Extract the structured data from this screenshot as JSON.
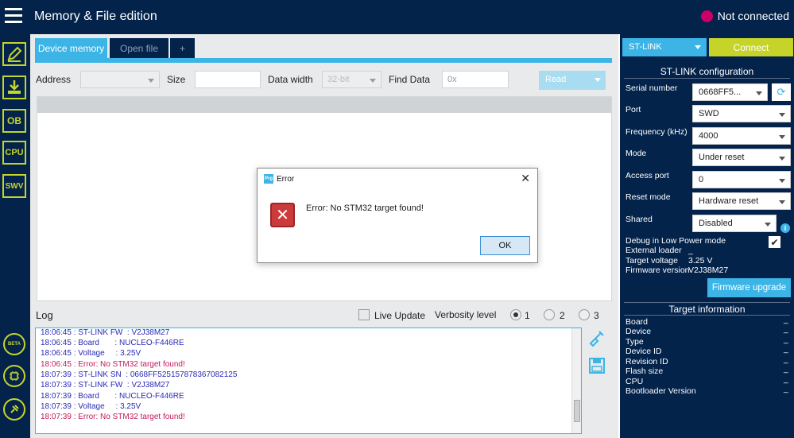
{
  "header": {
    "title": "Memory & File edition",
    "status": "Not connected",
    "status_color": "#cc0066"
  },
  "sidebar": {
    "items": [
      {
        "name": "edit-icon"
      },
      {
        "name": "download-icon"
      },
      {
        "label": "OB"
      },
      {
        "label": "CPU"
      },
      {
        "label": "SWV"
      },
      {
        "label": "BETA"
      },
      {
        "name": "chip-icon"
      },
      {
        "name": "plugin-icon"
      }
    ]
  },
  "tabs": [
    {
      "label": "Device memory"
    },
    {
      "label": "Open file"
    },
    {
      "label": "+"
    }
  ],
  "toolbar": {
    "address_label": "Address",
    "size_label": "Size",
    "data_width_label": "Data width",
    "data_width_value": "32-bit",
    "find_data_label": "Find Data",
    "find_data_placeholder": "0x",
    "read_label": "Read"
  },
  "log": {
    "label": "Log",
    "live_update_label": "Live Update",
    "verbosity_label": "Verbosity level",
    "levels": [
      "1",
      "2",
      "3"
    ],
    "selected_level": "1",
    "lines": [
      {
        "text": "18:06:45 : ST-LINK FW  : V2J38M27",
        "type": "info"
      },
      {
        "text": "18:06:45 : Board       : NUCLEO-F446RE",
        "type": "info"
      },
      {
        "text": "18:06:45 : Voltage     : 3.25V",
        "type": "info"
      },
      {
        "text": "18:06:45 : Error: No STM32 target found!",
        "type": "error"
      },
      {
        "text": "18:07:39 : ST-LINK SN  : 0668FF525157878367082125",
        "type": "info"
      },
      {
        "text": "18:07:39 : ST-LINK FW  : V2J38M27",
        "type": "info"
      },
      {
        "text": "18:07:39 : Board       : NUCLEO-F446RE",
        "type": "info"
      },
      {
        "text": "18:07:39 : Voltage     : 3.25V",
        "type": "info"
      },
      {
        "text": "18:07:39 : Error: No STM32 target found!",
        "type": "error"
      }
    ]
  },
  "dialog": {
    "title": "Error",
    "app_icon_text": "Prg",
    "message": "Error: No STM32 target found!",
    "ok_label": "OK"
  },
  "right_panel": {
    "interface": "ST-LINK",
    "connect_label": "Connect",
    "config_title": "ST-LINK configuration",
    "serial_number_label": "Serial number",
    "serial_number_value": "0668FF5...",
    "port_label": "Port",
    "port_value": "SWD",
    "frequency_label": "Frequency (kHz)",
    "frequency_value": "4000",
    "mode_label": "Mode",
    "mode_value": "Under reset",
    "access_port_label": "Access port",
    "access_port_value": "0",
    "reset_mode_label": "Reset mode",
    "reset_mode_value": "Hardware reset",
    "shared_label": "Shared",
    "shared_value": "Disabled",
    "debug_low_power_label": "Debug in Low Power mode",
    "external_loader_label": "External loader",
    "external_loader_value": "_",
    "target_voltage_label": "Target voltage",
    "target_voltage_value": "3.25 V",
    "firmware_version_label": "Firmware version",
    "firmware_version_value": "V2J38M27",
    "firmware_upgrade_label": "Firmware upgrade",
    "target_info_title": "Target information",
    "target_info": [
      {
        "label": "Board",
        "value": "_"
      },
      {
        "label": "Device",
        "value": "_"
      },
      {
        "label": "Type",
        "value": "_"
      },
      {
        "label": "Device ID",
        "value": "_"
      },
      {
        "label": "Revision ID",
        "value": "_"
      },
      {
        "label": "Flash size",
        "value": "_"
      },
      {
        "label": "CPU",
        "value": "_"
      },
      {
        "label": "Bootloader Version",
        "value": "_"
      }
    ]
  },
  "colors": {
    "navy": "#03234b",
    "accent_blue": "#3cb4e6",
    "lime": "#c6d429",
    "error_red": "#cc3b3b"
  }
}
